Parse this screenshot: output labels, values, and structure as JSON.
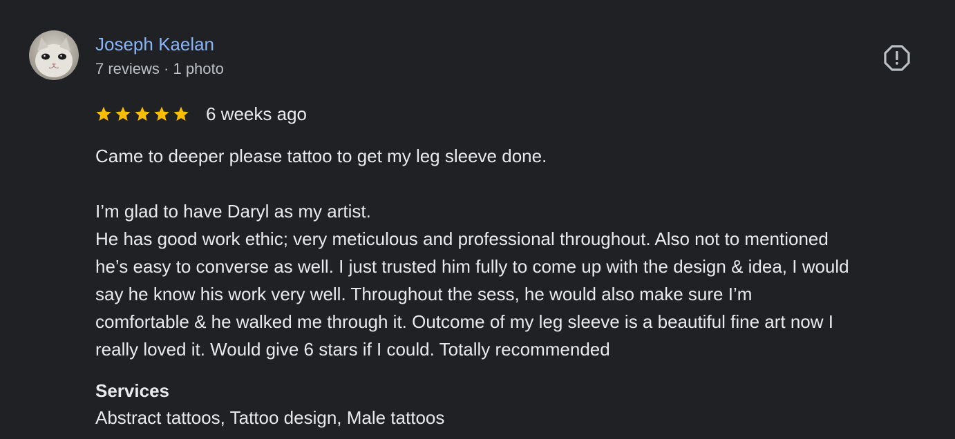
{
  "reviewer": {
    "name": "Joseph Kaelan",
    "meta": "7 reviews · 1 photo",
    "avatar_icon": "cat-photo-avatar"
  },
  "actions": {
    "report_icon": "report-octagon-icon"
  },
  "rating": {
    "stars": 5,
    "max": 5,
    "star_color": "#fbbc04",
    "date": "6 weeks ago"
  },
  "review": {
    "line1": "Came to deeper please tattoo to get my leg sleeve done.",
    "line2": "I’m glad to have Daryl as my artist.",
    "line3": "He has good work ethic; very meticulous and professional throughout. Also not to mentioned",
    "line4": "he’s easy to converse as well. I just trusted him fully to come up with the design & idea, I would",
    "line5": "say he know his work very well. Throughout the sess, he would also make sure I’m",
    "line6": "comfortable & he walked me through it. Outcome of my leg sleeve is a beautiful fine art now I",
    "line7": "really loved it. Would give 6 stars if I could. Totally recommended"
  },
  "services": {
    "heading": "Services",
    "list": "Abstract tattoos, Tattoo design, Male tattoos"
  },
  "colors": {
    "background": "#202124",
    "name_link": "#8ab4f8",
    "text": "#e8eaed",
    "secondary_text": "#bdc1c6"
  }
}
